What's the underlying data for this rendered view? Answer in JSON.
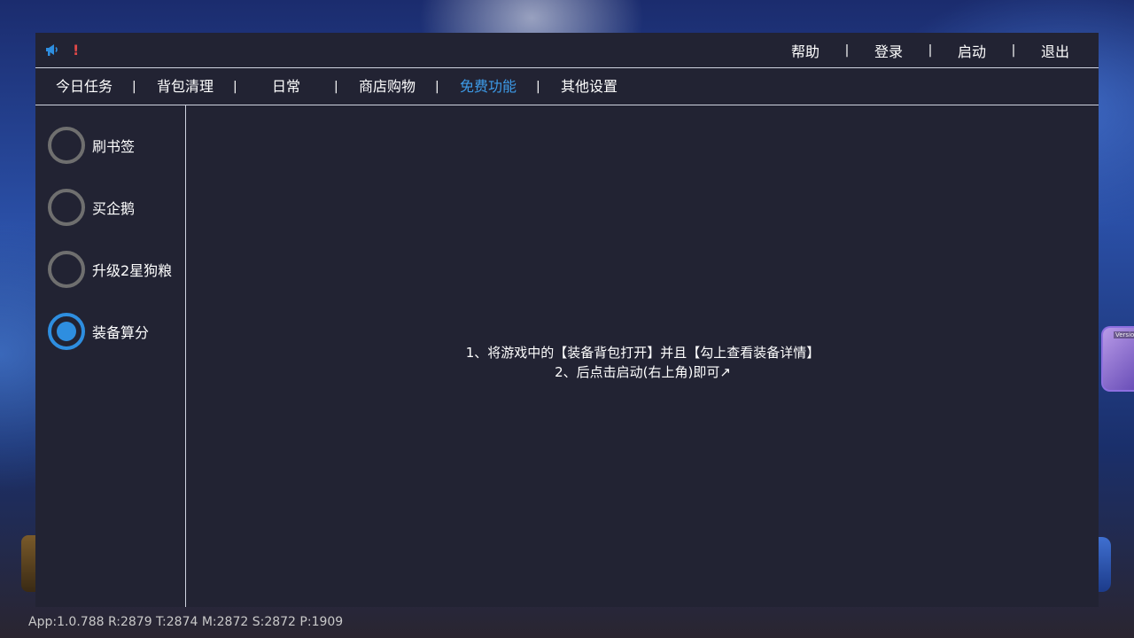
{
  "topbar": {
    "icon": "megaphone-icon",
    "alert_mark": "!",
    "actions": [
      {
        "label": "帮助"
      },
      {
        "label": "登录"
      },
      {
        "label": "启动"
      },
      {
        "label": "退出"
      }
    ],
    "separator": "|"
  },
  "tabs": [
    {
      "label": "今日任务",
      "active": false
    },
    {
      "label": "背包清理",
      "active": false
    },
    {
      "label": "日常",
      "active": false
    },
    {
      "label": "商店购物",
      "active": false
    },
    {
      "label": "免费功能",
      "active": true
    },
    {
      "label": "其他设置",
      "active": false
    }
  ],
  "sidebar": {
    "options": [
      {
        "label": "刷书签",
        "selected": false
      },
      {
        "label": "买企鹅",
        "selected": false
      },
      {
        "label": "升级2星狗粮",
        "selected": false
      },
      {
        "label": "装备算分",
        "selected": true
      }
    ]
  },
  "content": {
    "line1": "1、将游戏中的【装备背包打开】并且【勾上查看装备详情】",
    "line2": "2、后点击启动(右上角)即可↗"
  },
  "background": {
    "thumb_label": "Version"
  },
  "statusbar": {
    "text": "App:1.0.788  R:2879 T:2874 M:2872 S:2872 P:1909"
  },
  "colors": {
    "panel_bg": "#222333",
    "accent": "#3d9be8",
    "radio_on": "#2e8ee0",
    "radio_off": "#6f6f6f",
    "alert": "#e04848"
  }
}
